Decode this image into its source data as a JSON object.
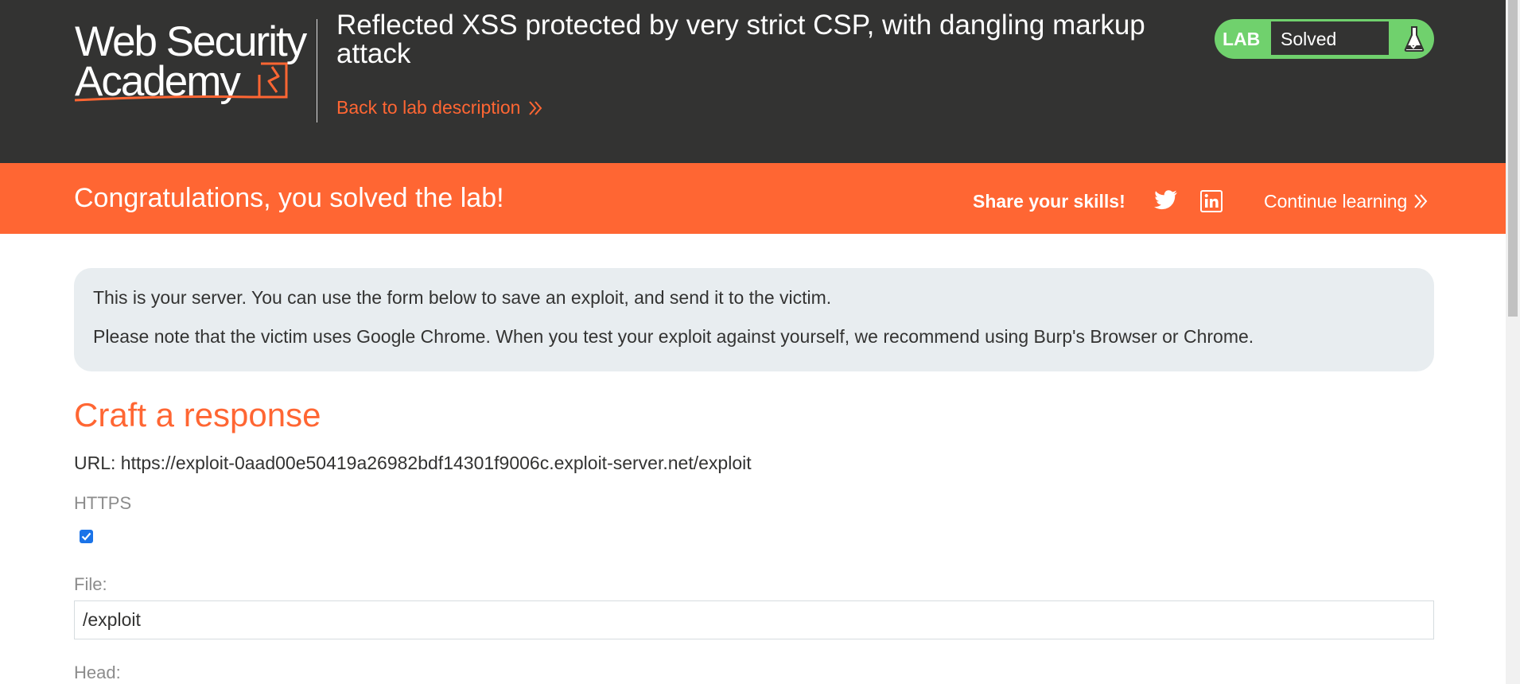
{
  "header": {
    "logo_line1": "Web Security",
    "logo_line2": "Academy",
    "lab_title": "Reflected XSS protected by very strict CSP, with dangling markup attack",
    "back_link": "Back to lab description"
  },
  "status_widget": {
    "tag": "LAB",
    "status": "Solved",
    "icon": "flask-icon"
  },
  "banner": {
    "message": "Congratulations, you solved the lab!",
    "share_label": "Share your skills!",
    "continue_label": "Continue learning"
  },
  "info": {
    "line1": "This is your server. You can use the form below to save an exploit, and send it to the victim.",
    "line2": "Please note that the victim uses Google Chrome. When you test your exploit against yourself, we recommend using Burp's Browser or Chrome."
  },
  "form": {
    "section_title": "Craft a response",
    "url_text": "URL: https://exploit-0aad00e50419a26982bdf14301f9006c.exploit-server.net/exploit",
    "https_label": "HTTPS",
    "https_checked": true,
    "file_label": "File:",
    "file_value": "/exploit",
    "head_label": "Head:"
  },
  "colors": {
    "accent": "#ff6633",
    "header_bg": "#333332",
    "solved_green": "#70d16d",
    "info_bg": "#e8edf0"
  }
}
